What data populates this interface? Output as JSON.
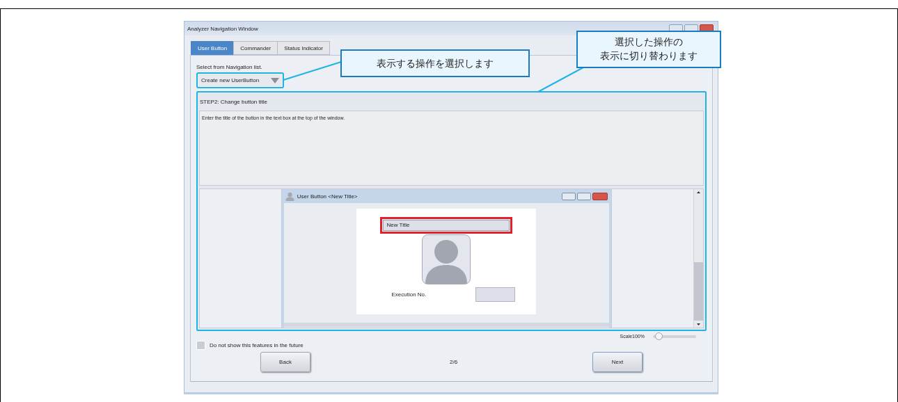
{
  "window": {
    "title": "Analyzer Navigation Window"
  },
  "tabs": [
    {
      "label": "User Button",
      "selected": true
    },
    {
      "label": "Commander",
      "selected": false
    },
    {
      "label": "Status Indicator",
      "selected": false
    }
  ],
  "navigation": {
    "label": "Select from Navigation list.",
    "value": "Create new UserButton"
  },
  "step": {
    "title": "STEP2: Change button title",
    "description": "Enter the title of the button in the text box at the top of the window."
  },
  "preview": {
    "title": "User Button <New Title>",
    "title_field": "New Title",
    "execution_label": "Execution No."
  },
  "scale": {
    "label": "Scale100%",
    "level": 0.05
  },
  "dont_show": {
    "label": "Do not show this features in the future",
    "checked": false
  },
  "nav_buttons": {
    "back": "Back",
    "page": "2/6",
    "next": "Next"
  },
  "callouts": [
    {
      "lines": [
        "表示する操作を選択します"
      ]
    },
    {
      "lines": [
        "選択した操作の",
        "表示に切り替わります"
      ]
    }
  ]
}
